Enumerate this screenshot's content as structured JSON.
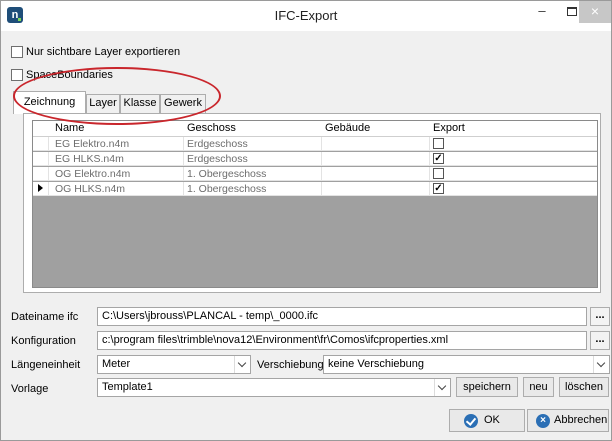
{
  "window": {
    "title": "IFC-Export",
    "icon_letter": "n",
    "minimize": "–",
    "close": "×"
  },
  "options": [
    {
      "label": "Nur sichtbare Layer exportieren",
      "checked": false
    },
    {
      "label": "SpaceBoundaries",
      "checked": false
    }
  ],
  "tabs": [
    "Zeichnung",
    "Layer",
    "Klasse",
    "Gewerk"
  ],
  "active_tab": "Zeichnung",
  "table": {
    "columns": [
      "Name",
      "Geschoss",
      "Gebäude",
      "Export"
    ],
    "rows": [
      {
        "name": "EG Elektro.n4m",
        "geschoss": "Erdgeschoss",
        "gebaeude": "",
        "export": false,
        "current": false
      },
      {
        "name": "EG HLKS.n4m",
        "geschoss": "Erdgeschoss",
        "gebaeude": "",
        "export": true,
        "current": false
      },
      {
        "name": "OG Elektro.n4m",
        "geschoss": "1. Obergeschoss",
        "gebaeude": "",
        "export": false,
        "current": false
      },
      {
        "name": "OG HLKS.n4m",
        "geschoss": "1. Obergeschoss",
        "gebaeude": "",
        "export": true,
        "current": true
      }
    ]
  },
  "form": {
    "dateiname_label": "Dateiname ifc",
    "dateiname_value": "C:\\Users\\jbrouss\\PLANCAL - temp\\_0000.ifc",
    "konfiguration_label": "Konfiguration",
    "konfiguration_value": "c:\\program files\\trimble\\nova12\\Environment\\fr\\Comos\\ifcproperties.xml",
    "laengeneinheit_label": "Längeneinheit",
    "laengeneinheit_value": "Meter",
    "verschiebung_label": "Verschiebung",
    "verschiebung_value": "keine Verschiebung",
    "vorlage_label": "Vorlage",
    "vorlage_value": "Template1",
    "browse_label": "...",
    "check_mark": "✓"
  },
  "buttons": {
    "speichern": "speichern",
    "neu": "neu",
    "loeschen": "löschen",
    "ok": "OK",
    "abbrechen": "Abbrechen",
    "cancel_glyph": "×"
  },
  "colors": {
    "annotation": "#c9262c",
    "grid_empty": "#a0a0a0",
    "icon_blue": "#2b6fb5"
  }
}
